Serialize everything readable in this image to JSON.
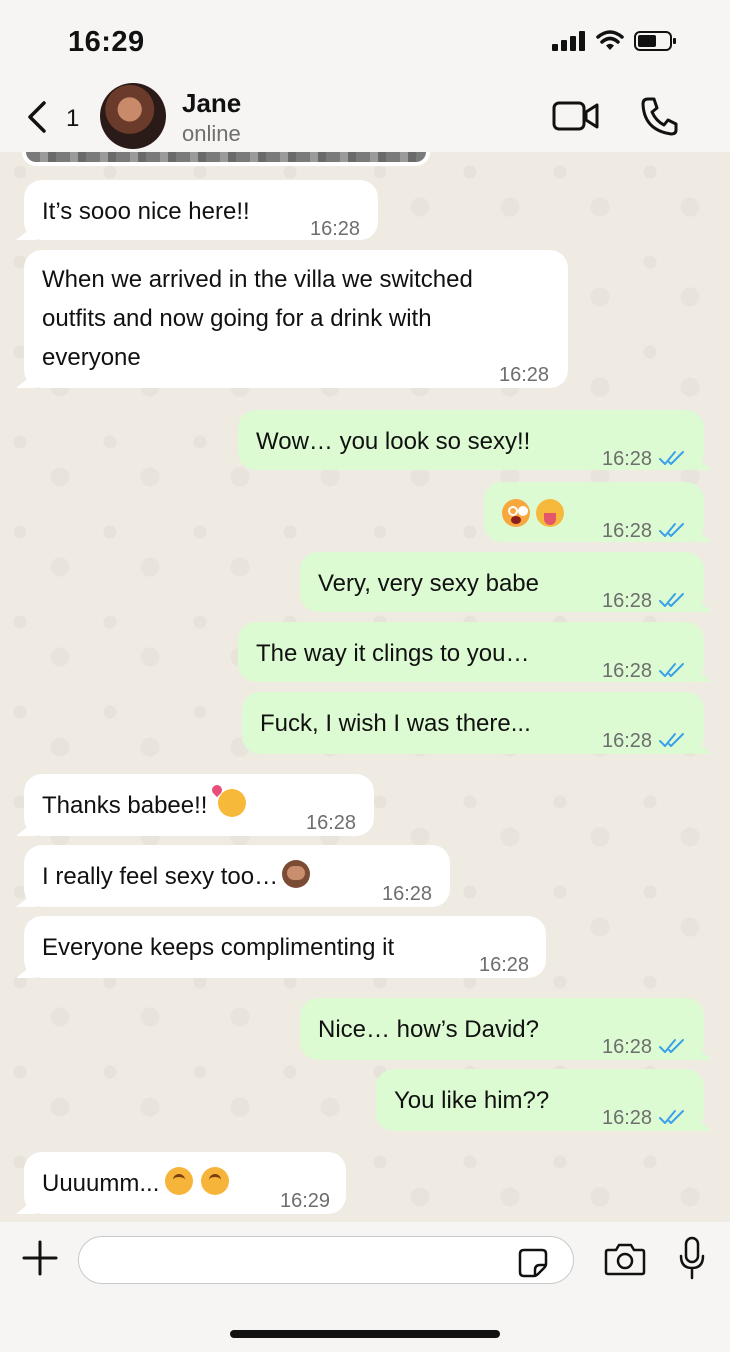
{
  "status_bar": {
    "time": "16:29"
  },
  "header": {
    "back_count": "1",
    "contact_name": "Jane",
    "contact_status": "online"
  },
  "colors": {
    "incoming_bubble": "#ffffff",
    "outgoing_bubble": "#dcfbd2",
    "read_ticks": "#3aa0e9",
    "timestamp": "#6e6e6e"
  },
  "messages": [
    {
      "dir": "in",
      "text": "It’s sooo nice here!!",
      "time": "16:28"
    },
    {
      "dir": "in",
      "lines": [
        "When we arrived in the villa we switched",
        "outfits and now going for a drink with",
        "everyone"
      ],
      "time": "16:28"
    },
    {
      "dir": "out",
      "text": "Wow… you look so sexy!!",
      "time": "16:28",
      "read": true
    },
    {
      "dir": "out",
      "emoji": [
        "flushed-face-emoji",
        "squinting-tongue-emoji"
      ],
      "time": "16:28",
      "read": true
    },
    {
      "dir": "out",
      "text": "Very, very sexy babe",
      "time": "16:28",
      "read": true
    },
    {
      "dir": "out",
      "text": "The way it clings to you…",
      "time": "16:28",
      "read": true
    },
    {
      "dir": "out",
      "text": "Fuck, I wish I was there...",
      "time": "16:28",
      "read": true
    },
    {
      "dir": "in",
      "text": "Thanks babee!!",
      "emoji": [
        "smiling-face-with-hearts-emoji"
      ],
      "time": "16:28"
    },
    {
      "dir": "in",
      "text": "I really feel sexy too…",
      "emoji": [
        "see-no-evil-monkey-emoji"
      ],
      "time": "16:28"
    },
    {
      "dir": "in",
      "text": "Everyone keeps complimenting it",
      "time": "16:28"
    },
    {
      "dir": "out",
      "text": "Nice… how’s David?",
      "time": "16:28",
      "read": true
    },
    {
      "dir": "out",
      "text": "You like him??",
      "time": "16:28",
      "read": true
    },
    {
      "dir": "in",
      "text": "Uuuumm...",
      "emoji": [
        "upside-down-face-emoji",
        "upside-down-face-emoji"
      ],
      "time": "16:29"
    }
  ],
  "input": {
    "placeholder": ""
  }
}
